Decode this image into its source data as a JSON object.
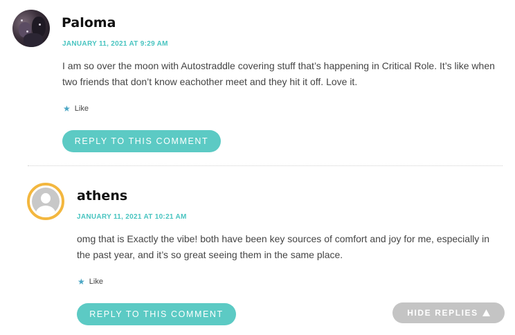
{
  "comments": [
    {
      "author": "Paloma",
      "date": "JANUARY 11, 2021 AT 9:29 AM",
      "text": "I am so over the moon with Autostraddle covering stuff that’s happening in Critical Role. It’s like when two friends that don’t know eachother meet and they hit it off. Love it.",
      "like_label": "Like",
      "reply_label": "REPLY TO THIS COMMENT",
      "avatar": "photo-avatar"
    },
    {
      "author": "athens",
      "date": "JANUARY 11, 2021 AT 10:21 AM",
      "text": "omg that is Exactly the vibe! both have been key sources of comfort and joy for me, especially in the past year, and it’s so great seeing them in the same place.",
      "like_label": "Like",
      "reply_label": "REPLY TO THIS COMMENT",
      "avatar": "default-avatar"
    }
  ],
  "hide_replies_label": "HIDE REPLIES",
  "icons": {
    "like": "star-icon",
    "hide": "triangle-up-icon"
  },
  "colors": {
    "accent": "#5ccac4",
    "date": "#48c4c0",
    "avatar_ring": "#f3b73f",
    "hide_button": "#c4c4c4"
  }
}
